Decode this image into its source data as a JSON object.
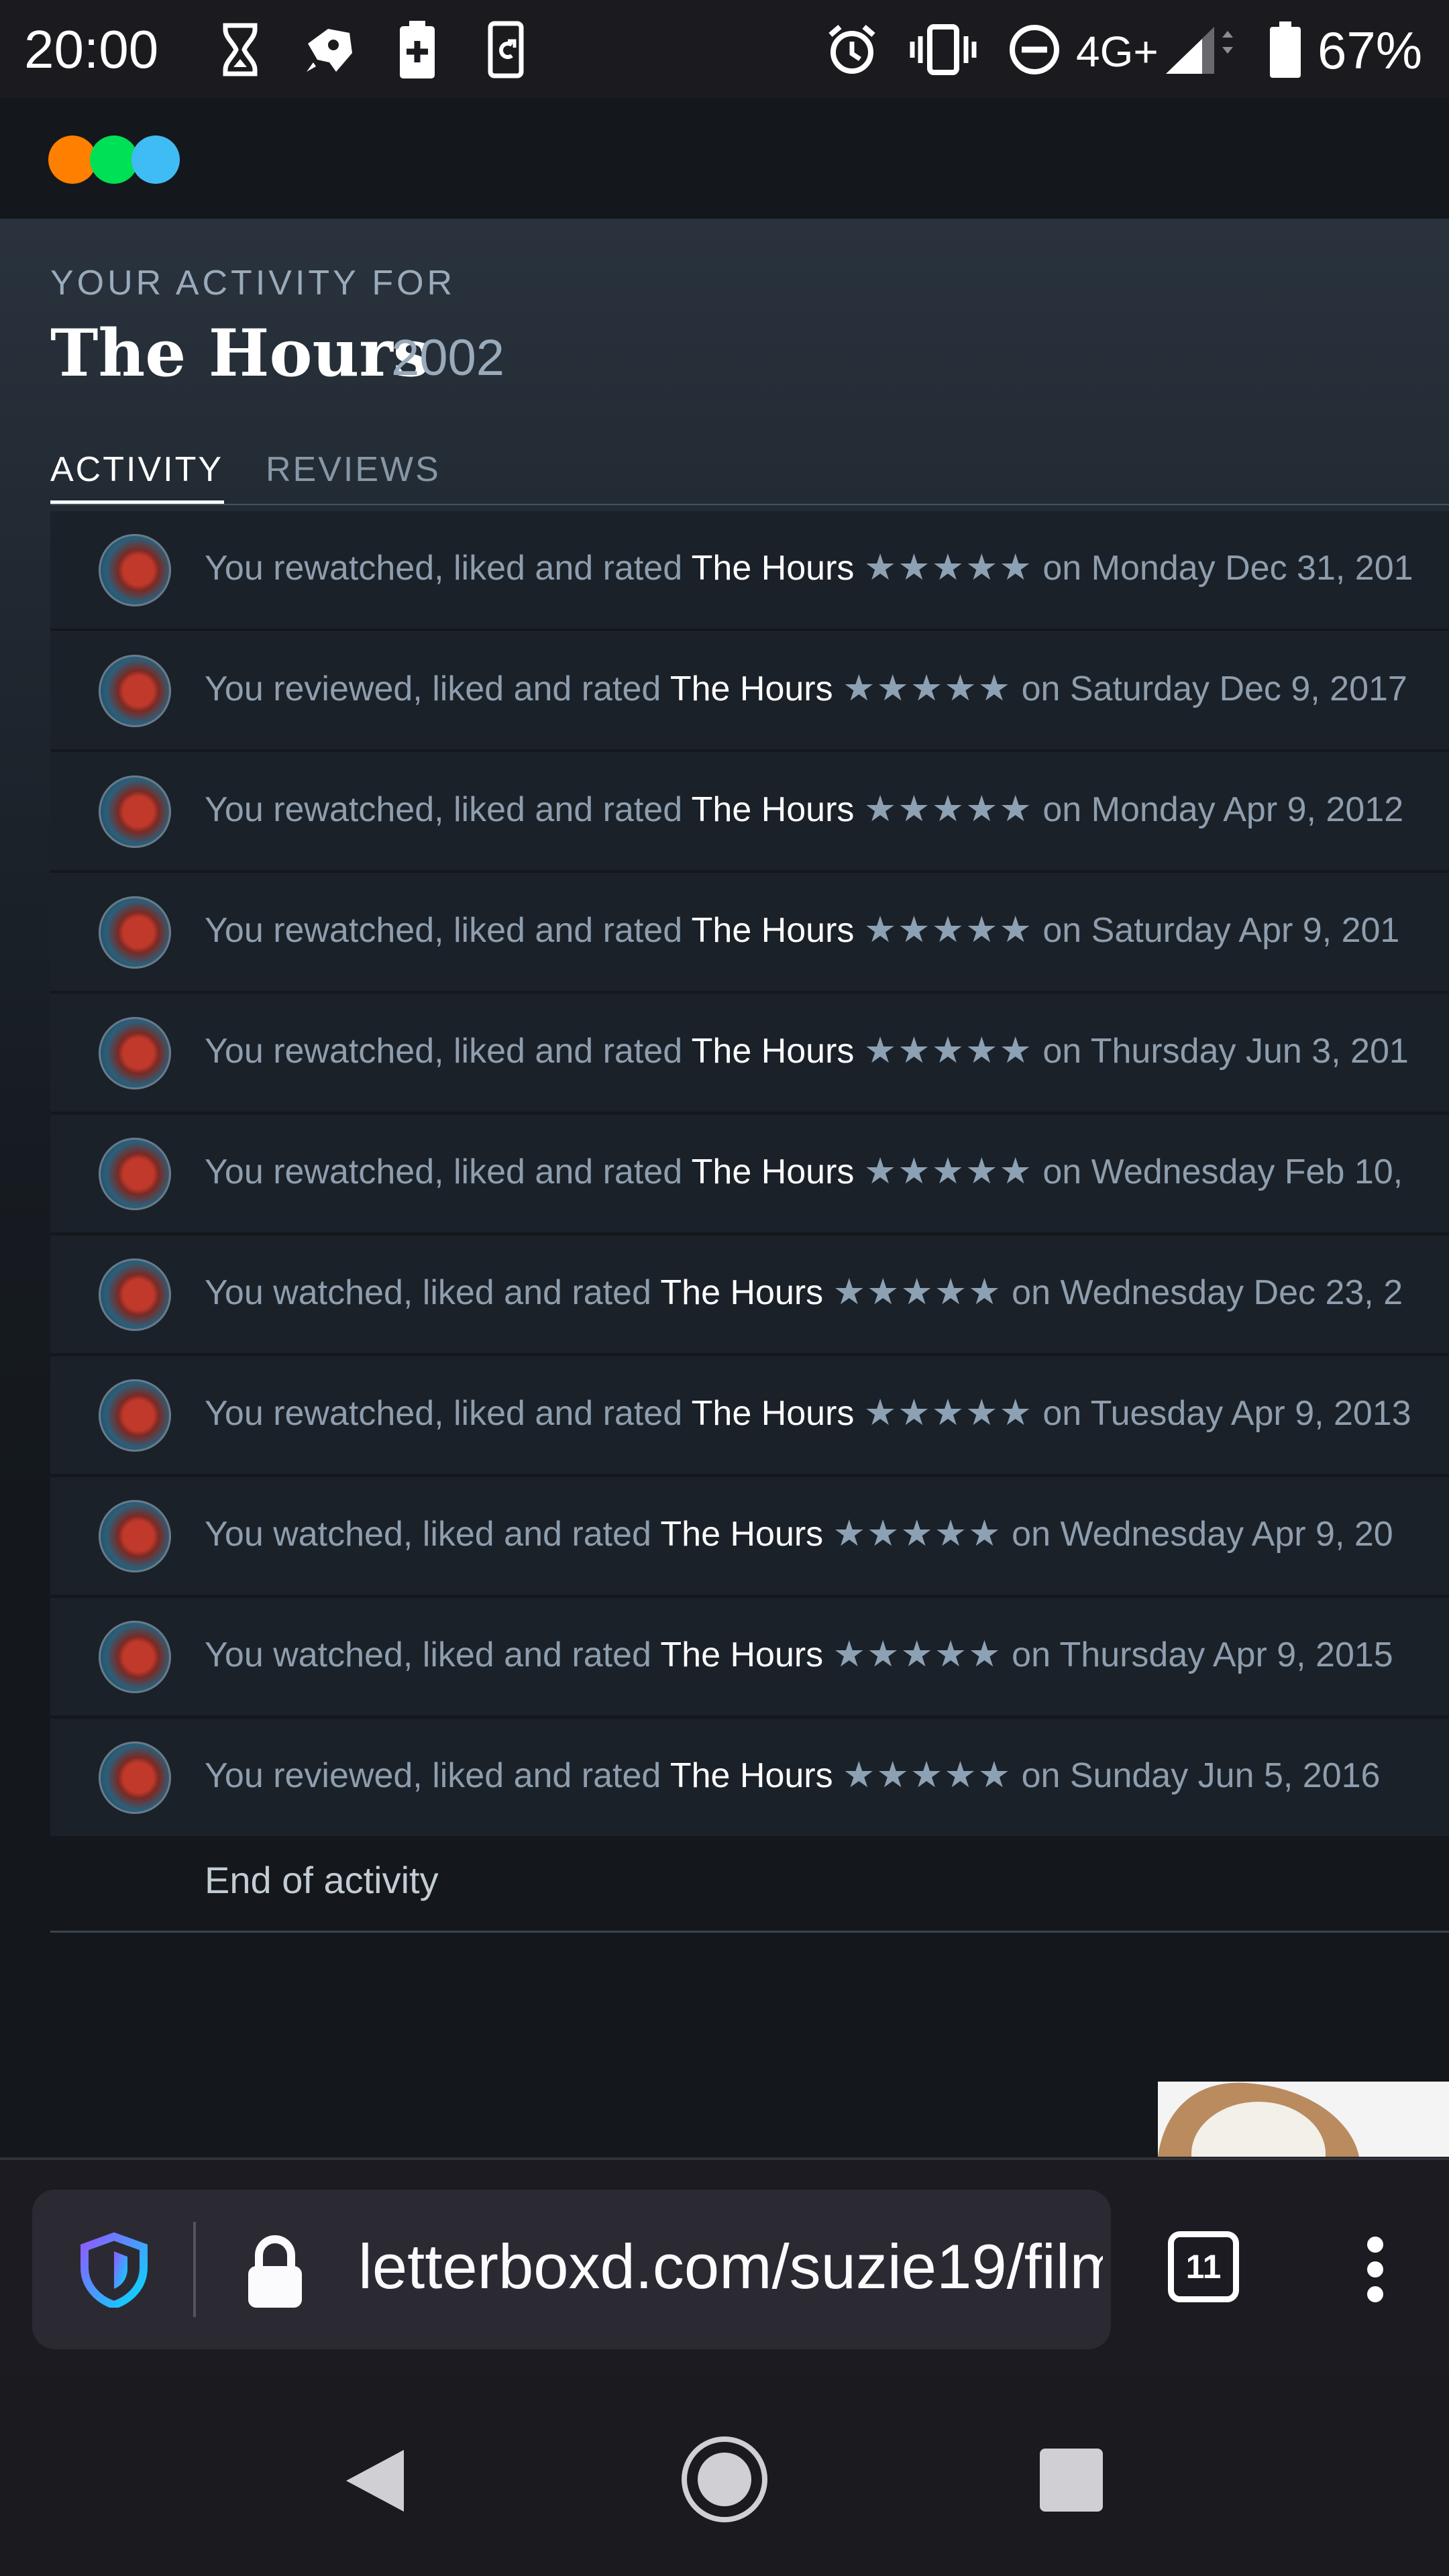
{
  "status_bar": {
    "time": "20:00",
    "network": "4G+",
    "battery": "67%",
    "icons": [
      "hourglass-icon",
      "rocket-icon",
      "battery-saver-icon",
      "sync-icon",
      "alarm-icon",
      "vibrate-icon",
      "do-not-disturb-icon",
      "signal-icon",
      "battery-icon"
    ]
  },
  "page": {
    "eyebrow": "YOUR ACTIVITY FOR",
    "film_title": "The Hours",
    "film_year": "2002",
    "tabs": [
      {
        "label": "ACTIVITY",
        "active": true
      },
      {
        "label": "REVIEWS",
        "active": false
      }
    ],
    "activity": [
      {
        "action": "You rewatched, liked and rated",
        "film": "The Hours",
        "stars": "★★★★★",
        "date": "on Monday Dec 31, 201"
      },
      {
        "action": "You reviewed, liked and rated",
        "film": "The Hours",
        "stars": "★★★★★",
        "date": "on Saturday Dec 9, 2017"
      },
      {
        "action": "You rewatched, liked and rated",
        "film": "The Hours",
        "stars": "★★★★★",
        "date": "on Monday Apr 9, 2012"
      },
      {
        "action": "You rewatched, liked and rated",
        "film": "The Hours",
        "stars": "★★★★★",
        "date": "on Saturday Apr 9, 201"
      },
      {
        "action": "You rewatched, liked and rated",
        "film": "The Hours",
        "stars": "★★★★★",
        "date": "on Thursday Jun 3, 201"
      },
      {
        "action": "You rewatched, liked and rated",
        "film": "The Hours",
        "stars": "★★★★★",
        "date": "on Wednesday Feb 10,"
      },
      {
        "action": "You watched, liked and rated",
        "film": "The Hours",
        "stars": "★★★★★",
        "date": "on Wednesday Dec 23, 2"
      },
      {
        "action": "You rewatched, liked and rated",
        "film": "The Hours",
        "stars": "★★★★★",
        "date": "on Tuesday Apr 9, 2013"
      },
      {
        "action": "You watched, liked and rated",
        "film": "The Hours",
        "stars": "★★★★★",
        "date": "on Wednesday Apr 9, 20"
      },
      {
        "action": "You watched, liked and rated",
        "film": "The Hours",
        "stars": "★★★★★",
        "date": "on Thursday Apr 9, 2015"
      },
      {
        "action": "You reviewed, liked and rated",
        "film": "The Hours",
        "stars": "★★★★★",
        "date": "on Sunday Jun 5, 2016"
      }
    ],
    "end_text": "End of activity"
  },
  "browser": {
    "url": "letterboxd.com/suzie19/film",
    "tab_count": "11"
  },
  "colors": {
    "brand_orange": "#ff8000",
    "brand_green": "#00e054",
    "brand_blue": "#40bcf4",
    "background": "#14181c"
  }
}
